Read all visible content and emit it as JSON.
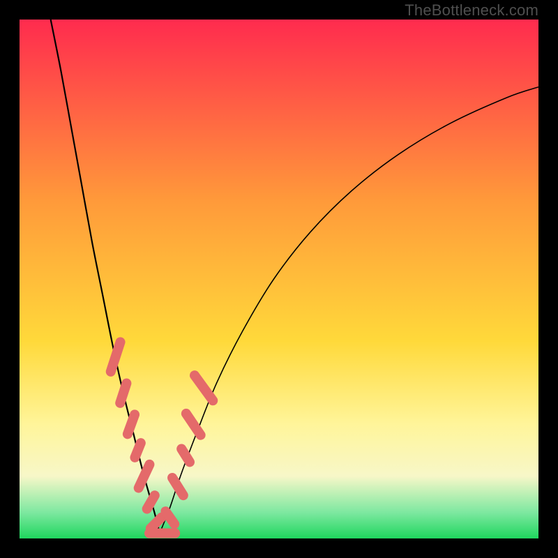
{
  "watermark": "TheBottleneck.com",
  "colors": {
    "top": "#ff2b4e",
    "orange": "#ff9a3a",
    "yellow": "#ffd93a",
    "pale": "#fff59a",
    "cream": "#f7f7c8",
    "mint": "#7de8a0",
    "green": "#1fd65e",
    "bead": "#e46a6a"
  },
  "chart_data": {
    "type": "line",
    "title": "",
    "xlabel": "",
    "ylabel": "",
    "xlim": [
      0,
      100
    ],
    "ylim": [
      0,
      100
    ],
    "note": "Axes unlabeled in source; x is normalized 0–100 left→right, y is 0 (bottom, green / no bottleneck) → 100 (top, red / severe bottleneck). V-shaped bottleneck curve with minimum near x≈27.",
    "series": [
      {
        "name": "left-branch",
        "x": [
          6,
          8,
          10,
          12,
          14,
          16,
          18,
          20,
          22,
          24,
          26,
          27
        ],
        "y": [
          100,
          90,
          79,
          68,
          57,
          47,
          37,
          28,
          20,
          12,
          5,
          1
        ]
      },
      {
        "name": "right-branch",
        "x": [
          27,
          29,
          31,
          34,
          38,
          43,
          49,
          56,
          64,
          73,
          83,
          94,
          100
        ],
        "y": [
          1,
          6,
          12,
          20,
          30,
          40,
          50,
          59,
          67,
          74,
          80,
          85,
          87
        ]
      }
    ],
    "beads": {
      "name": "highlight-markers",
      "note": "Clustered salmon capsule markers along lower portion of both branches near the trough.",
      "points": [
        {
          "x": 18.5,
          "y": 35,
          "len": 6,
          "angle": -72
        },
        {
          "x": 20.0,
          "y": 28,
          "len": 4,
          "angle": -72
        },
        {
          "x": 21.5,
          "y": 22,
          "len": 4,
          "angle": -70
        },
        {
          "x": 22.8,
          "y": 17,
          "len": 3,
          "angle": -68
        },
        {
          "x": 24.0,
          "y": 12,
          "len": 5,
          "angle": -65
        },
        {
          "x": 25.3,
          "y": 7,
          "len": 3,
          "angle": -60
        },
        {
          "x": 26.3,
          "y": 3,
          "len": 3,
          "angle": -45
        },
        {
          "x": 27.5,
          "y": 1,
          "len": 5,
          "angle": 0
        },
        {
          "x": 29.0,
          "y": 4,
          "len": 3,
          "angle": 55
        },
        {
          "x": 30.5,
          "y": 10,
          "len": 4,
          "angle": 58
        },
        {
          "x": 32.0,
          "y": 16,
          "len": 3,
          "angle": 58
        },
        {
          "x": 33.5,
          "y": 22,
          "len": 5,
          "angle": 56
        },
        {
          "x": 35.5,
          "y": 29,
          "len": 6,
          "angle": 54
        }
      ]
    }
  }
}
